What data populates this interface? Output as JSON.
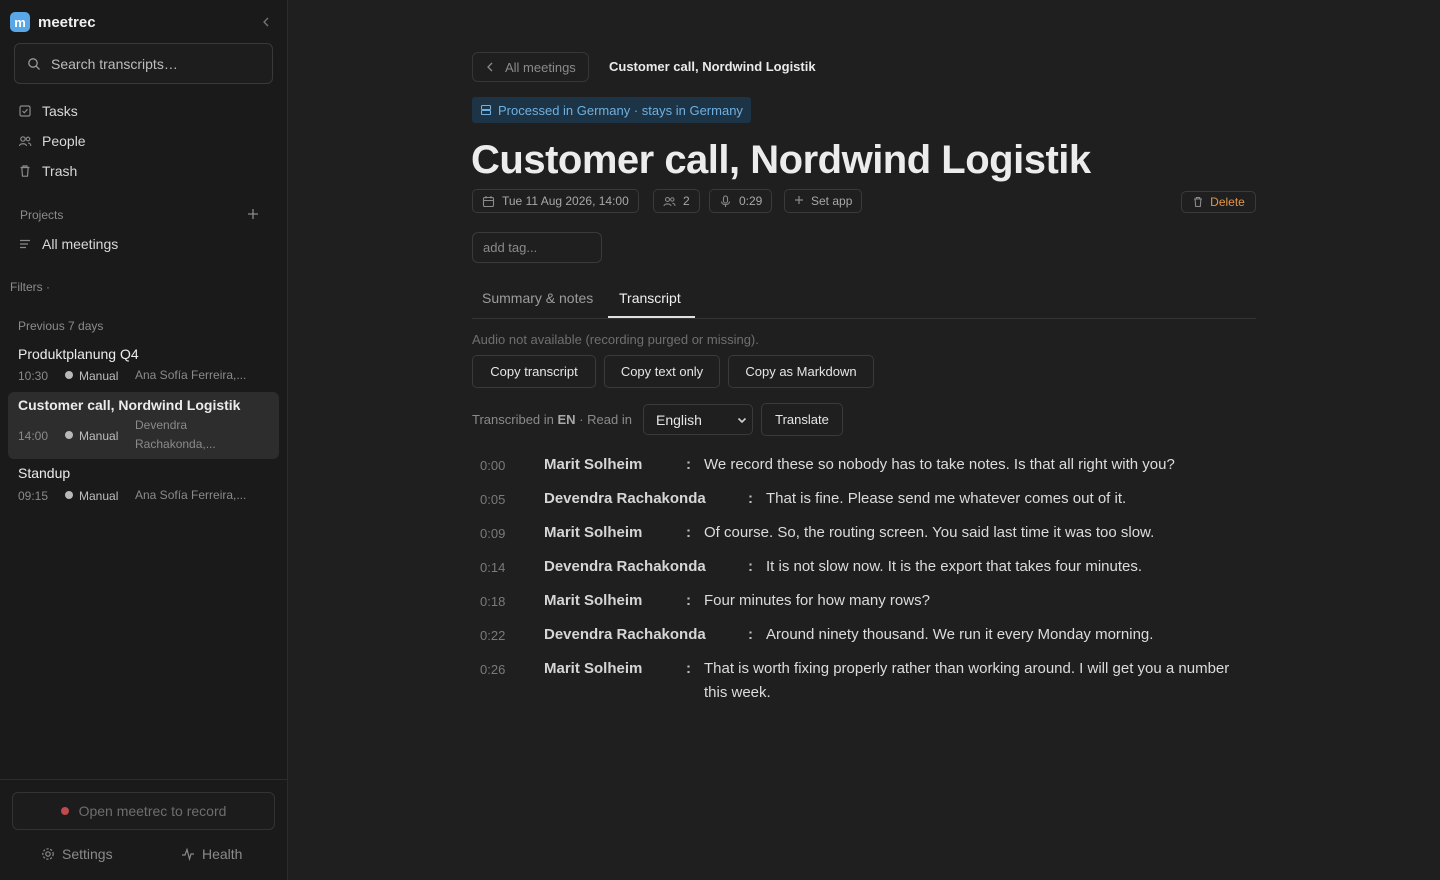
{
  "app": {
    "name": "meetrec",
    "logo_letter": "m"
  },
  "sidebar": {
    "search_placeholder": "Search transcripts…",
    "nav": [
      {
        "label": "Tasks",
        "icon": "checkbox-icon"
      },
      {
        "label": "People",
        "icon": "people-icon"
      },
      {
        "label": "Trash",
        "icon": "trash-icon"
      }
    ],
    "projects_label": "Projects",
    "all_meetings_label": "All meetings",
    "filters_label": "Filters ·",
    "group_label": "Previous 7 days",
    "meetings": [
      {
        "title": "Produktplanung Q4",
        "time": "10:30",
        "source": "Manual",
        "people": "Ana Sofía Ferreira,..."
      },
      {
        "title": "Customer call, Nordwind Logistik",
        "time": "14:00",
        "source": "Manual",
        "people": "Devendra Rachakonda,..."
      },
      {
        "title": "Standup",
        "time": "09:15",
        "source": "Manual",
        "people": "Ana Sofía Ferreira,..."
      }
    ],
    "record_label": "Open meetrec to record",
    "settings_label": "Settings",
    "health_label": "Health"
  },
  "main": {
    "back_label": "All meetings",
    "breadcrumb": "Customer call, Nordwind Logistik",
    "region_badge": "Processed in Germany · stays in Germany",
    "title": "Customer call, Nordwind Logistik",
    "date": "Tue 11 Aug 2026, 14:00",
    "participants": "2",
    "duration": "0:29",
    "set_app_label": "Set app",
    "delete_label": "Delete",
    "tag_placeholder": "add tag...",
    "tabs": [
      {
        "label": "Summary & notes",
        "active": false
      },
      {
        "label": "Transcript",
        "active": true
      }
    ],
    "audio_note": "Audio not available (recording purged or missing).",
    "actions": [
      "Copy transcript",
      "Copy text only",
      "Copy as Markdown"
    ],
    "transcribed_prefix": "Transcribed in",
    "transcribed_lang": "EN",
    "read_in_label": "· Read in",
    "language": "English",
    "translate_label": "Translate"
  },
  "transcript": [
    {
      "time": "0:00",
      "speaker": "Marit Solheim",
      "text": "We record these so nobody has to take notes. Is that all right with you?"
    },
    {
      "time": "0:05",
      "speaker": "Devendra Rachakonda",
      "text": "That is fine. Please send me whatever comes out of it."
    },
    {
      "time": "0:09",
      "speaker": "Marit Solheim",
      "text": "Of course. So, the routing screen. You said last time it was too slow."
    },
    {
      "time": "0:14",
      "speaker": "Devendra Rachakonda",
      "text": "It is not slow now. It is the export that takes four minutes."
    },
    {
      "time": "0:18",
      "speaker": "Marit Solheim",
      "text": "Four minutes for how many rows?"
    },
    {
      "time": "0:22",
      "speaker": "Devendra Rachakonda",
      "text": "Around ninety thousand. We run it every Monday morning."
    },
    {
      "time": "0:26",
      "speaker": "Marit Solheim",
      "text": "That is worth fixing properly rather than working around. I will get you a number this week."
    }
  ],
  "colors": {
    "accent": "#5aa7e8",
    "delete": "#e0954a",
    "record": "#c0494c",
    "badge_bg": "#1d3446"
  }
}
